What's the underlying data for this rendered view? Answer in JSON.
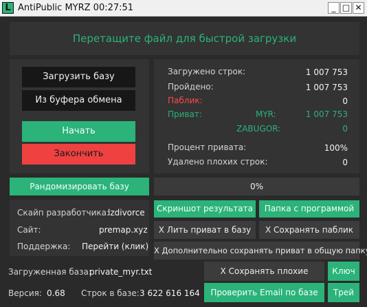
{
  "window": {
    "icon_letter": "L",
    "title": "AntiPublic MYRZ 00:27:51",
    "minimize_glyph": "_",
    "maximize_glyph": "□",
    "close_glyph": "✕"
  },
  "dropzone": {
    "text": "Перетащите файл для быстрой загрузки"
  },
  "actions": {
    "load_db": "Загрузить базу",
    "from_clipboard": "Из буфера обмена",
    "start": "Начать",
    "finish": "Закончить",
    "randomize": "Рандомизировать базу"
  },
  "stats": {
    "loaded_label": "Загружено строк:",
    "loaded_value": "1 007 753",
    "passed_label": "Пройдено:",
    "passed_value": "1 007 753",
    "public_label": "Паблик:",
    "public_value": "0",
    "private_label": "Приват:",
    "myr_label": "MYR:",
    "myr_value": "1 007 753",
    "zabugor_label": "ZABUGOR:",
    "zabugor_value": "0",
    "private_percent_label": "Процент привата:",
    "private_percent_value": "100%",
    "removed_label": "Удалено плохих строк:",
    "removed_value": "0"
  },
  "progress": {
    "text": "0%",
    "value": 0
  },
  "info": {
    "dev_skype_label": "Скайп разработчика:",
    "dev_skype_value": "lzdivorce",
    "site_label": "Сайт:",
    "site_value": "premap.xyz",
    "support_label": "Поддержка:",
    "support_value": "Перейти (клик)"
  },
  "tools": {
    "screenshot": "Скриншот результата",
    "program_folder": "Папка с программой",
    "pour_private": "Лить приват в базу",
    "save_public": "Сохранять паблик",
    "save_private_common": "Дополнительно сохранять приват в общую папку",
    "save_bad": "Сохранять плохие строки",
    "key": "Ключ",
    "check_email": "Проверить Email по базе",
    "tray": "Трей",
    "check_mark": "X"
  },
  "footer": {
    "loaded_db_label": "Загруженная база:",
    "loaded_db_value": "private_myr.txt",
    "version_label": "Версия:",
    "version_value": "0.68",
    "lines_label": "Строк в базе:",
    "lines_value": "3 622 616 164"
  },
  "colors": {
    "accent": "#2bb37a",
    "danger": "#f04141",
    "background": "#2a2a2a",
    "panel": "#333333"
  }
}
